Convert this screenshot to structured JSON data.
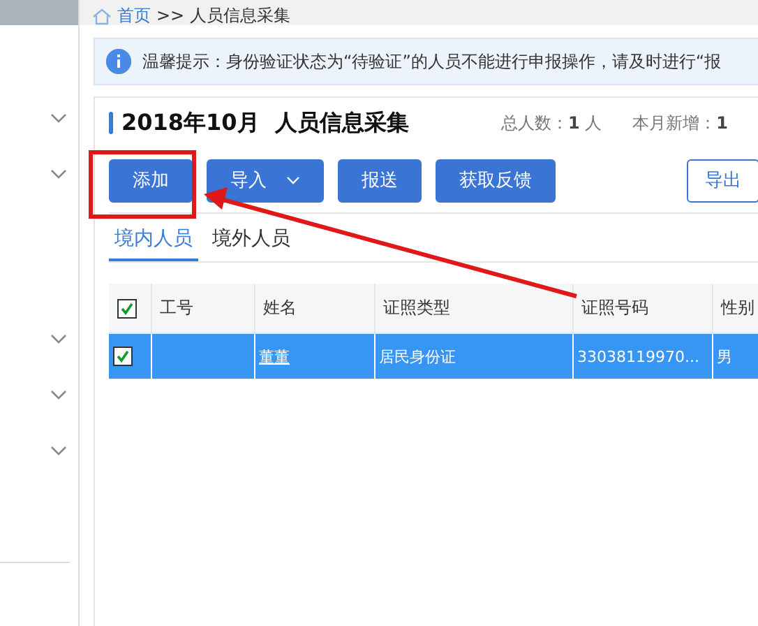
{
  "sidebar": {
    "items": [
      {
        "expanded": false
      },
      {
        "expanded": false
      },
      {
        "expanded": false
      },
      {
        "expanded": false
      },
      {
        "expanded": false
      }
    ]
  },
  "breadcrumb": {
    "home": "首页",
    "separator": ">>",
    "current": "人员信息采集"
  },
  "notice": {
    "text": "温馨提示：身份验证状态为“待验证”的人员不能进行申报操作，请及时进行“报"
  },
  "header": {
    "title": "2018年10月  人员信息采集",
    "stats": [
      {
        "label": "总人数：",
        "value": "1",
        "unit": "人"
      },
      {
        "label": "本月新增：",
        "value": "1"
      }
    ]
  },
  "toolbar": {
    "buttons": [
      {
        "label": "添加",
        "kind": "primary"
      },
      {
        "label": "导入",
        "kind": "dropdown"
      },
      {
        "label": "报送",
        "kind": "primary"
      },
      {
        "label": "获取反馈",
        "kind": "primary"
      },
      {
        "label": "导出",
        "kind": "outline"
      }
    ]
  },
  "tabs": [
    {
      "label": "境内人员",
      "selected": true
    },
    {
      "label": "境外人员",
      "selected": false
    }
  ],
  "table": {
    "all_checked": true,
    "columns": [
      "工号",
      "姓名",
      "证照类型",
      "证照号码",
      "性别"
    ],
    "rows": [
      {
        "checked": true,
        "selected": true,
        "cells": [
          "",
          "董董",
          "居民身份证",
          "33038119970...",
          "男"
        ]
      }
    ]
  }
}
